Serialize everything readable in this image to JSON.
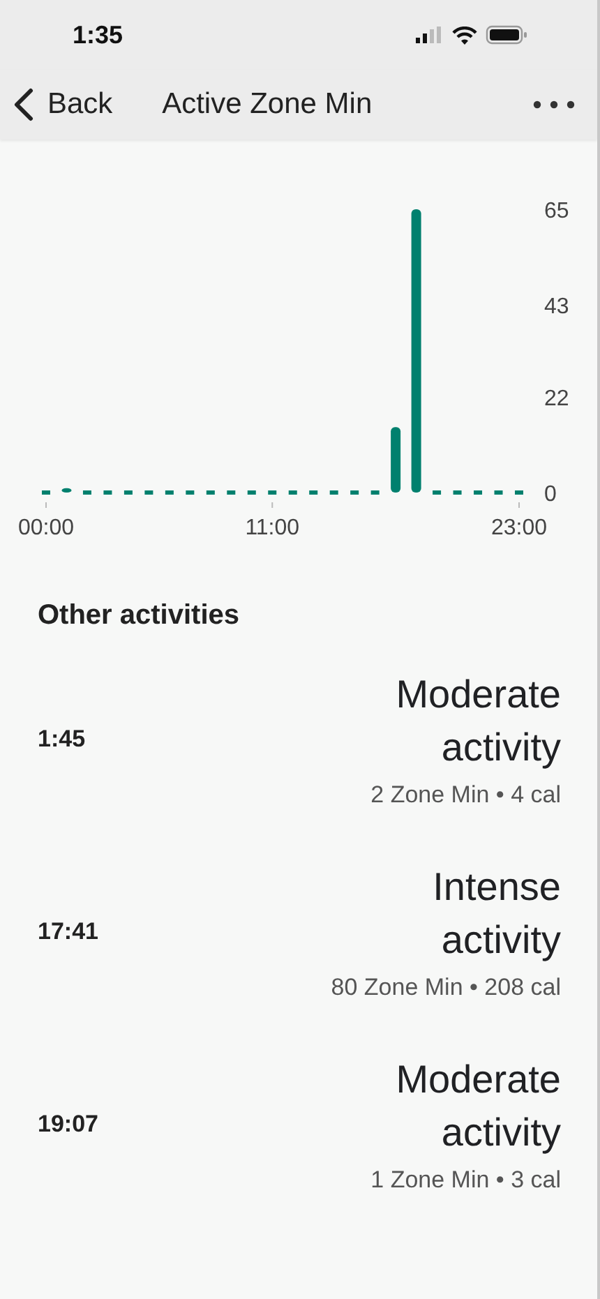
{
  "status_bar": {
    "time": "1:35"
  },
  "header": {
    "back_label": "Back",
    "title": "Active Zone Min"
  },
  "chart": {
    "chart_data": {
      "type": "bar",
      "x": [
        0,
        1,
        2,
        3,
        4,
        5,
        6,
        7,
        8,
        9,
        10,
        11,
        12,
        13,
        14,
        15,
        16,
        17,
        18,
        19,
        20,
        21,
        22,
        23
      ],
      "xlim": [
        0,
        23
      ],
      "series": [
        {
          "color": "#00806e",
          "values": [
            0,
            1,
            0,
            0,
            0,
            0,
            0,
            0,
            0,
            0,
            0,
            0,
            0,
            0,
            0,
            0,
            0,
            15,
            65,
            0,
            0,
            0,
            0,
            0
          ]
        }
      ],
      "ylim": [
        0,
        65
      ],
      "yticks": [
        0,
        22,
        43,
        65
      ],
      "xticks": [
        {
          "value": 0,
          "label": "00:00"
        },
        {
          "value": 11,
          "label": "11:00"
        },
        {
          "value": 23,
          "label": "23:00"
        }
      ]
    }
  },
  "section_title": "Other activities",
  "activities": [
    {
      "time": "1:45",
      "name": "Moderate activity",
      "detail": "2 Zone Min • 4 cal"
    },
    {
      "time": "17:41",
      "name": "Intense activity",
      "detail": "80 Zone Min • 208 cal"
    },
    {
      "time": "19:07",
      "name": "Moderate activity",
      "detail": "1 Zone Min • 3 cal"
    }
  ]
}
